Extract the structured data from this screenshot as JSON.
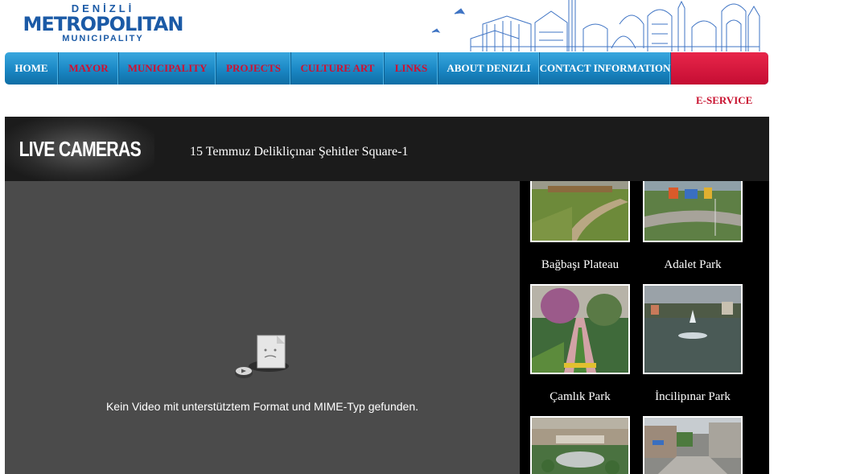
{
  "logo": {
    "line1": "DENİZLİ",
    "line2": "METROPOLITAN",
    "line3": "MUNICIPALITY"
  },
  "nav": {
    "items": [
      {
        "label": "HOME",
        "color": "white"
      },
      {
        "label": "MAYOR",
        "color": "red"
      },
      {
        "label": "MUNICIPALITY",
        "color": "red"
      },
      {
        "label": "PROJECTS",
        "color": "red"
      },
      {
        "label": "CULTURE ART",
        "color": "red"
      },
      {
        "label": "LINKS",
        "color": "red"
      },
      {
        "label": "ABOUT DENIZLI",
        "color": "white"
      },
      {
        "label": "CONTACT INFORMATION",
        "color": "white"
      }
    ],
    "eservice_label": "E-SERVICE"
  },
  "live": {
    "title": "LIVE CAMERAS",
    "current_camera": "15 Temmuz Deliklіçınar Şehitler Square-1",
    "video_message": "Kein Video mit unterstütztem Format und MIME-Typ gefunden."
  },
  "cameras": [
    {
      "name": "Bağbaşı Plateau"
    },
    {
      "name": "Adalet Park"
    },
    {
      "name": "Çamlık Park"
    },
    {
      "name": "İncilipınar Park"
    },
    {
      "name": ""
    },
    {
      "name": ""
    }
  ],
  "colors": {
    "nav_blue": "#1a87c4",
    "accent_red": "#c8102e",
    "logo_blue": "#1b5aa6"
  }
}
